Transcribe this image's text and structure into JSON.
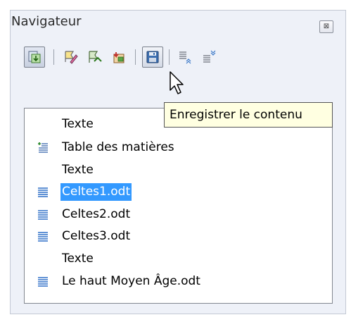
{
  "navigator": {
    "title": "Navigateur",
    "close_icon": "close-icon",
    "toolbar": [
      {
        "name": "toggle-icon",
        "tooltip": ""
      },
      {
        "name": "edit-icon",
        "tooltip": ""
      },
      {
        "name": "insert-icon",
        "tooltip": ""
      },
      {
        "name": "text-icon",
        "tooltip": ""
      },
      {
        "name": "save-icon",
        "tooltip": "Enregistrer le contenu"
      },
      {
        "name": "move-up-icon",
        "tooltip": ""
      },
      {
        "name": "move-down-icon",
        "tooltip": ""
      }
    ],
    "tooltip_text": "Enregistrer le contenu",
    "items": [
      {
        "label": "Texte",
        "icon": "none",
        "selected": false
      },
      {
        "label": "Table des matières",
        "icon": "index-icon",
        "selected": false
      },
      {
        "label": "Texte",
        "icon": "none",
        "selected": false
      },
      {
        "label": "Celtes1.odt",
        "icon": "document-link-icon",
        "selected": true
      },
      {
        "label": "Celtes2.odt",
        "icon": "document-link-icon",
        "selected": false
      },
      {
        "label": "Celtes3.odt",
        "icon": "document-link-icon",
        "selected": false
      },
      {
        "label": "Texte",
        "icon": "none",
        "selected": false
      },
      {
        "label": "Le haut Moyen Âge.odt",
        "icon": "document-link-icon",
        "selected": false
      }
    ]
  },
  "colors": {
    "selection": "#3399ff",
    "tooltip_bg": "#ffffe1",
    "panel_bg": "#eef1f8"
  }
}
